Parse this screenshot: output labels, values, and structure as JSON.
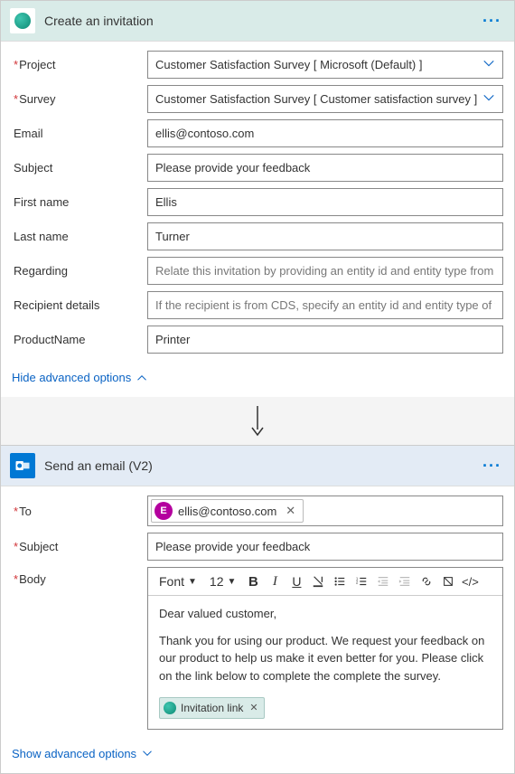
{
  "invitation": {
    "title": "Create an invitation",
    "fields": {
      "project": {
        "label": "Project",
        "value": "Customer Satisfaction Survey [ Microsoft (Default) ]"
      },
      "survey": {
        "label": "Survey",
        "value": "Customer Satisfaction Survey [ Customer satisfaction survey ]"
      },
      "email": {
        "label": "Email",
        "value": "ellis@contoso.com"
      },
      "subject": {
        "label": "Subject",
        "value": "Please provide your feedback"
      },
      "first_name": {
        "label": "First name",
        "value": "Ellis"
      },
      "last_name": {
        "label": "Last name",
        "value": "Turner"
      },
      "regarding": {
        "label": "Regarding",
        "placeholder": "Relate this invitation by providing an entity id and entity type from this CDS in t"
      },
      "recipient_details": {
        "label": "Recipient details",
        "placeholder": "If the recipient is from CDS, specify an entity id and entity type of the recipient t"
      },
      "product_name": {
        "label": "ProductName",
        "value": "Printer"
      }
    },
    "hide_advanced": "Hide advanced options"
  },
  "email": {
    "title": "Send an email (V2)",
    "fields": {
      "to": {
        "label": "To",
        "avatar_initial": "E",
        "value": "ellis@contoso.com"
      },
      "subject": {
        "label": "Subject",
        "value": "Please provide your feedback"
      },
      "body": {
        "label": "Body"
      }
    },
    "toolbar": {
      "font": "Font",
      "size": "12"
    },
    "body_content": {
      "greeting": "Dear valued customer,",
      "para": "Thank you for using our product. We request your feedback on our product to help us make it even better for you. Please click on the link below to complete the complete the survey.",
      "token": "Invitation link"
    },
    "show_advanced": "Show advanced options"
  },
  "required_mark": "*"
}
